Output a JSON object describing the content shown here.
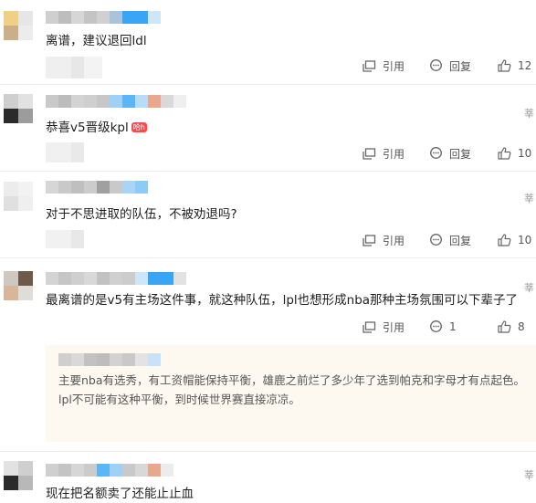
{
  "comments": [
    {
      "text": "离谱，建议退回ldl",
      "quote_label": "引用",
      "reply_label": "回复",
      "like_count": "12",
      "time_fragment": ""
    },
    {
      "text": "恭喜v5晋级kpl",
      "badge": "哈h",
      "quote_label": "引用",
      "reply_label": "回复",
      "like_count": "10",
      "time_fragment": "莘"
    },
    {
      "text": "对于不思进取的队伍，不被劝退吗?",
      "quote_label": "引用",
      "reply_label": "回复",
      "like_count": "10",
      "time_fragment": "莘"
    },
    {
      "text": "最离谱的是v5有主场这件事，就这种队伍，lpl也想形成nba那种主场氛围可以下辈子了",
      "quote_label": "引用",
      "reply_count": "1",
      "like_count": "8",
      "time_fragment": "莘",
      "reply": {
        "text": "主要nba有选秀，有工资帽能保持平衡，雄鹿之前烂了多少年了选到帕克和字母才有点起色。lpl不可能有这种平衡，到时候世界赛直接凉凉。"
      }
    },
    {
      "text": "现在把名额卖了还能止止血",
      "time_fragment": "莘"
    }
  ],
  "icons": {
    "quote": "quote-icon",
    "reply": "comment-bubble-icon",
    "like": "thumbs-up-icon"
  },
  "colors": {
    "text": "#1f1f1f",
    "action_text": "#555555",
    "reply_bg": "#fdf9f0",
    "badge": "#ef4f4f",
    "highlight_blue": "#3aa4f5"
  }
}
